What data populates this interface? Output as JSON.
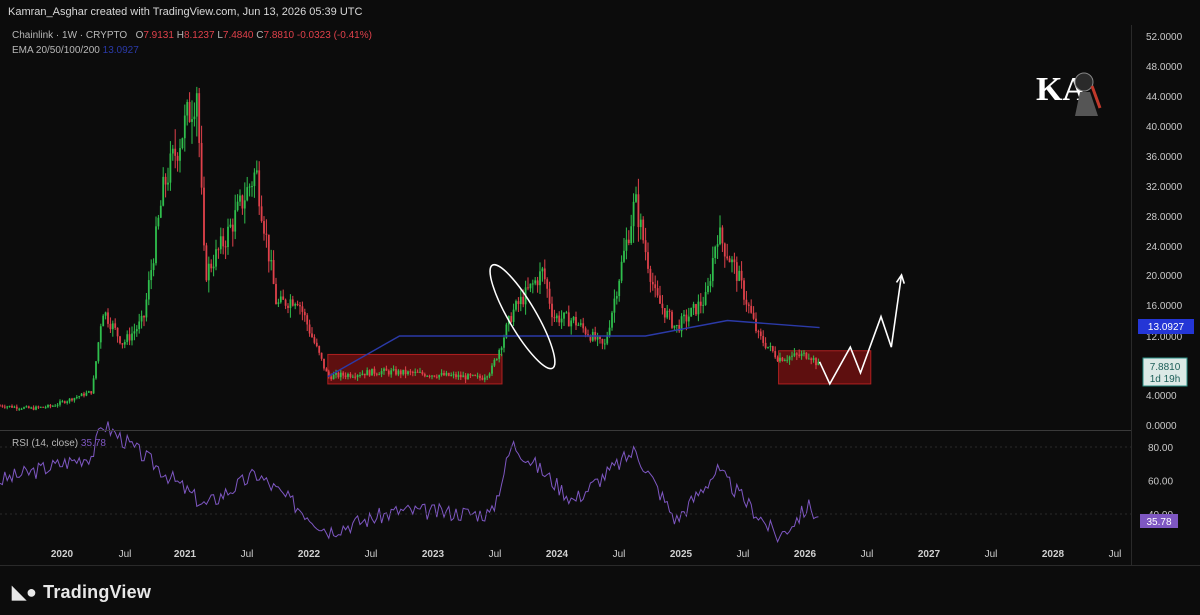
{
  "header": {
    "attribution": "Kamran_Asghar created with TradingView.com, Jun 13, 2026 05:39 UTC"
  },
  "legend": {
    "symbol": "Chainlink · 1W · CRYPTO",
    "o_label": "O",
    "o_value": "7.9131",
    "h_label": "H",
    "h_value": "8.1237",
    "l_label": "L",
    "l_value": "7.4840",
    "c_label": "C",
    "c_value": "7.8810",
    "change": "-0.0323 (-0.41%)",
    "ema_label": "EMA 20/50/100/200",
    "ema_value": "13.0927"
  },
  "rsi": {
    "label": "RSI (14, close)",
    "value": "35.78"
  },
  "price_badges": {
    "ema": "13.0927",
    "price": "7.8810",
    "countdown": "1d 19h",
    "rsi": "35.78"
  },
  "brand": {
    "text": "TradingView",
    "watermark_letters": "KA"
  },
  "colors": {
    "up": "#26a69a",
    "up_bright": "#2fbf4d",
    "down": "#e0414b",
    "ema": "#2b3aa8",
    "rsi": "#7e57c2",
    "zone": "#7a1010",
    "ema_badge": "#2436d6",
    "price_badge": "#2a8f86"
  },
  "chart_data": {
    "type": "candlestick",
    "price_axis": {
      "labels": [
        "52.0000",
        "48.0000",
        "44.0000",
        "40.0000",
        "36.0000",
        "32.0000",
        "28.0000",
        "24.0000",
        "20.0000",
        "16.0000",
        "12.0000",
        "4.0000",
        "0.0000"
      ],
      "scale": "log"
    },
    "rsi_axis": {
      "labels": [
        "80.00",
        "60.00",
        "40.00"
      ],
      "ylim": [
        0,
        100
      ]
    },
    "x_axis": {
      "labels": [
        "2020",
        "Jul",
        "2021",
        "Jul",
        "2022",
        "Jul",
        "2023",
        "Jul",
        "2024",
        "Jul",
        "2025",
        "Jul",
        "2026",
        "Jul",
        "2027",
        "Jul",
        "2028",
        "Jul"
      ]
    },
    "price_path": [
      [
        "2019-10",
        2.6
      ],
      [
        "2020-01",
        2.2
      ],
      [
        "2020-03",
        2.5
      ],
      [
        "2020-07",
        4.5
      ],
      [
        "2020-08",
        15.5
      ],
      [
        "2020-10",
        11.0
      ],
      [
        "2020-12",
        14.0
      ],
      [
        "2021-02",
        32.0
      ],
      [
        "2021-05",
        44.0
      ],
      [
        "2021-05",
        52.0
      ],
      [
        "2021-06",
        20.0
      ],
      [
        "2021-08",
        25.0
      ],
      [
        "2021-11",
        34.0
      ],
      [
        "2022-01",
        16.0
      ],
      [
        "2022-03",
        17.0
      ],
      [
        "2022-06",
        6.5
      ],
      [
        "2022-11",
        7.2
      ],
      [
        "2023-04",
        6.8
      ],
      [
        "2023-09",
        6.3
      ],
      [
        "2023-10",
        7.5
      ],
      [
        "2023-12",
        15.0
      ],
      [
        "2024-03",
        20.5
      ],
      [
        "2024-04",
        14.5
      ],
      [
        "2024-06",
        14.0
      ],
      [
        "2024-09",
        10.5
      ],
      [
        "2024-12",
        30.0
      ],
      [
        "2025-02",
        17.0
      ],
      [
        "2025-04",
        13.0
      ],
      [
        "2025-07",
        17.0
      ],
      [
        "2025-08",
        26.0
      ],
      [
        "2025-10",
        20.0
      ],
      [
        "2025-12",
        12.0
      ],
      [
        "2026-02",
        9.0
      ],
      [
        "2026-05",
        9.5
      ],
      [
        "2026-06",
        7.88
      ]
    ],
    "ema_path": [
      [
        "2022-06",
        6.5
      ],
      [
        "2023-01",
        12.0
      ],
      [
        "2024-01",
        12.0
      ],
      [
        "2025-01",
        12.0
      ],
      [
        "2025-09",
        14.0
      ],
      [
        "2026-06",
        13.09
      ]
    ],
    "rsi_path": [
      [
        "2019-10",
        60
      ],
      [
        "2020-07",
        75
      ],
      [
        "2020-08",
        94
      ],
      [
        "2021-01",
        70
      ],
      [
        "2021-06",
        45
      ],
      [
        "2021-11",
        64
      ],
      [
        "2022-06",
        30
      ],
      [
        "2023-01",
        42
      ],
      [
        "2023-10",
        40
      ],
      [
        "2023-12",
        82
      ],
      [
        "2024-06",
        48
      ],
      [
        "2024-12",
        78
      ],
      [
        "2025-04",
        36
      ],
      [
        "2025-08",
        66
      ],
      [
        "2026-02",
        26
      ],
      [
        "2026-05",
        45
      ],
      [
        "2026-06",
        35.78
      ]
    ],
    "annotations": [
      {
        "type": "zone",
        "from": "2022-06",
        "to": "2023-11",
        "low": 5.5,
        "high": 9.5
      },
      {
        "type": "ellipse",
        "from": "2023-10",
        "to": "2024-04",
        "low": 7.5,
        "high": 21.5
      },
      {
        "type": "zone",
        "from": "2026-02",
        "to": "2026-11",
        "low": 5.5,
        "high": 10.0
      },
      {
        "type": "projection_arrow",
        "points": [
          [
            "2026-06",
            8.5
          ],
          [
            "2026-07",
            5.5
          ],
          [
            "2026-09",
            10.5
          ],
          [
            "2026-10",
            7.0
          ],
          [
            "2026-12",
            14.5
          ],
          [
            "2027-01",
            10.5
          ],
          [
            "2027-02",
            20.0
          ]
        ]
      }
    ]
  }
}
